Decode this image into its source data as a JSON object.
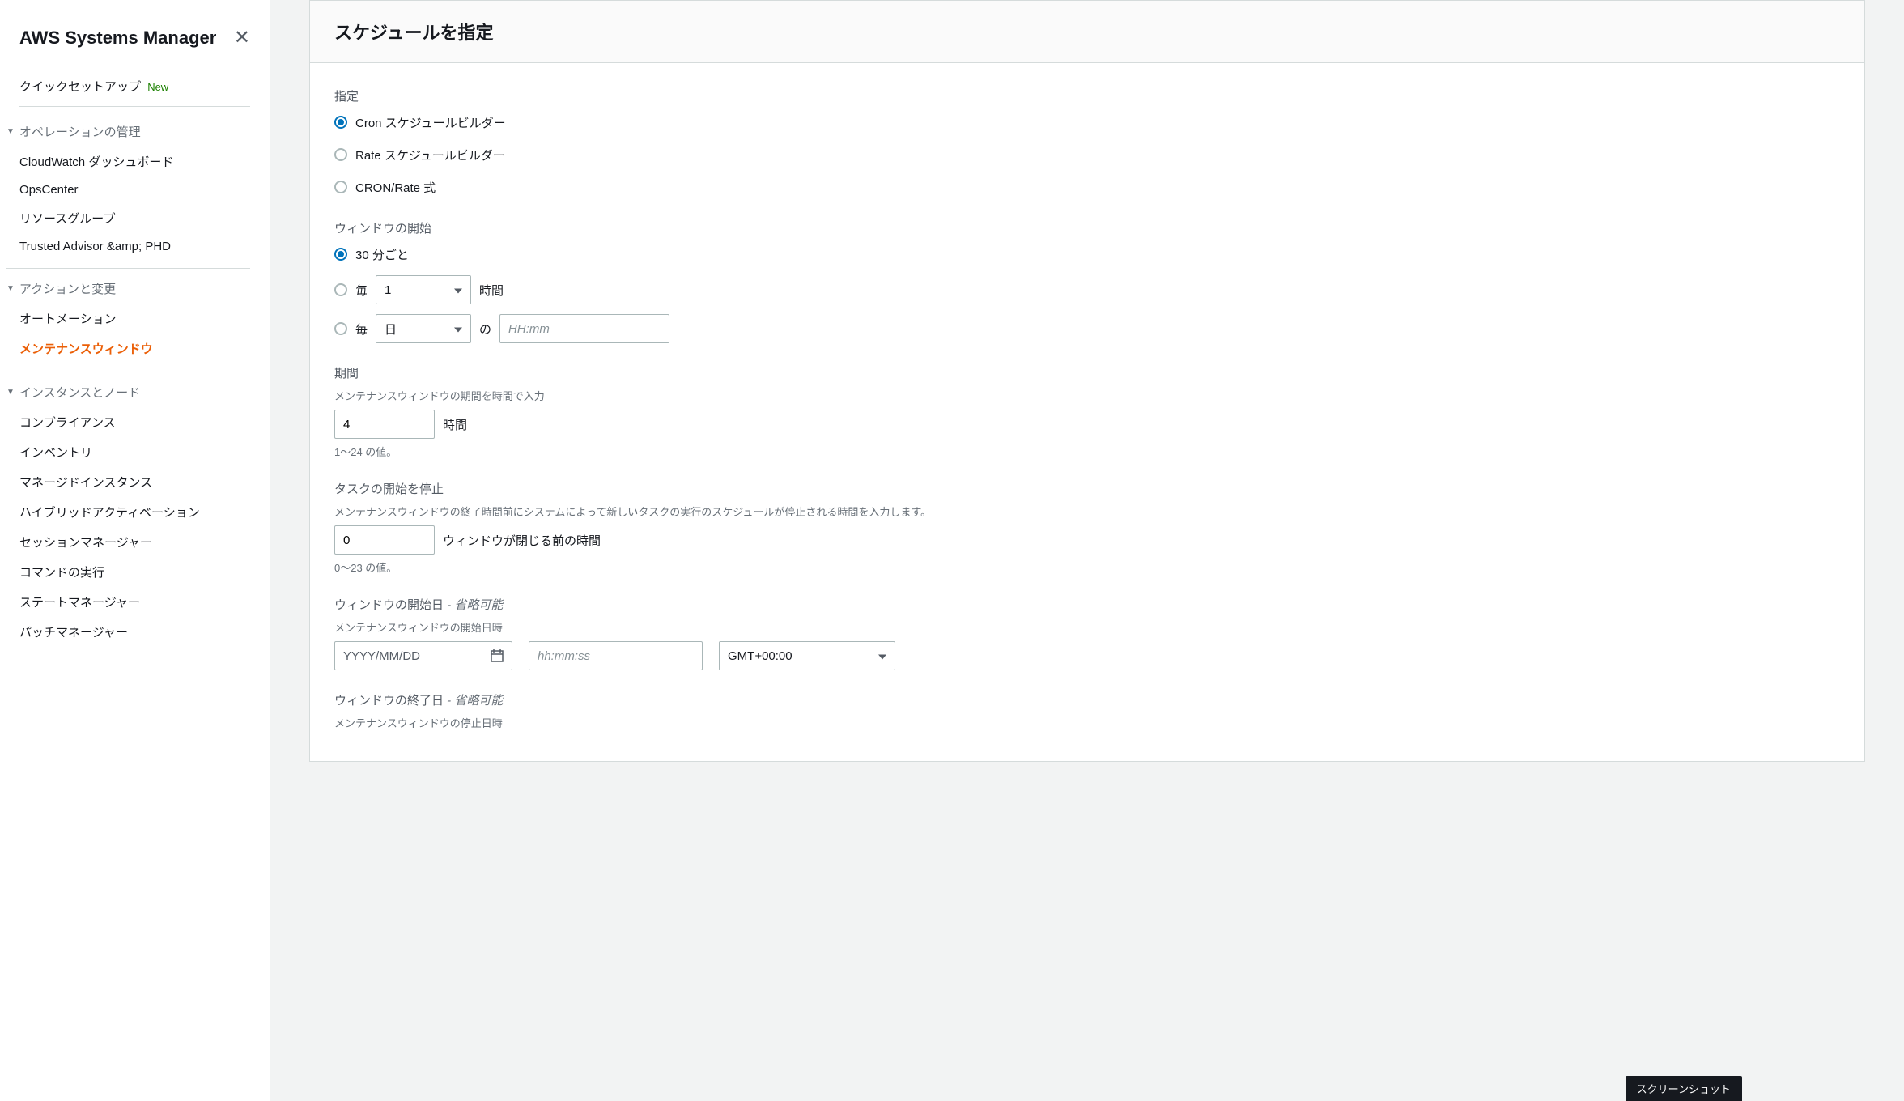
{
  "sidebar": {
    "title": "AWS Systems Manager",
    "quick_setup": "クイックセットアップ",
    "new_badge": "New",
    "sections": [
      {
        "header": "オペレーションの管理",
        "items": [
          "CloudWatch ダッシュボード",
          "OpsCenter",
          "リソースグループ",
          "Trusted Advisor &amp; PHD"
        ]
      },
      {
        "header": "アクションと変更",
        "items": [
          "オートメーション",
          "メンテナンスウィンドウ"
        ],
        "active_index": 1
      },
      {
        "header": "インスタンスとノード",
        "items": [
          "コンプライアンス",
          "インベントリ",
          "マネージドインスタンス",
          "ハイブリッドアクティベーション",
          "セッションマネージャー",
          "コマンドの実行",
          "ステートマネージャー",
          "パッチマネージャー"
        ]
      }
    ]
  },
  "panel": {
    "title": "スケジュールを指定",
    "specify": {
      "label": "指定",
      "options": [
        "Cron スケジュールビルダー",
        "Rate スケジュールビルダー",
        "CRON/Rate 式"
      ]
    },
    "window_start": {
      "label": "ウィンドウの開始",
      "opt_30min": "30 分ごと",
      "opt_every_prefix": "毎",
      "opt_every_value": "1",
      "opt_every_unit": "時間",
      "opt_every_day_prefix": "毎",
      "opt_every_day_value": "日",
      "opt_every_day_sep": "の",
      "opt_time_placeholder": "HH:mm"
    },
    "duration": {
      "label": "期間",
      "hint": "メンテナンスウィンドウの期間を時間で入力",
      "value": "4",
      "suffix": "時間",
      "constraint": "1〜24 の値。"
    },
    "stop_tasks": {
      "label": "タスクの開始を停止",
      "hint": "メンテナンスウィンドウの終了時間前にシステムによって新しいタスクの実行のスケジュールが停止される時間を入力します。",
      "value": "0",
      "suffix": "ウィンドウが閉じる前の時間",
      "constraint": "0〜23 の値。"
    },
    "start_date": {
      "label": "ウィンドウの開始日",
      "optional": " - 省略可能",
      "hint": "メンテナンスウィンドウの開始日時",
      "date_placeholder": "YYYY/MM/DD",
      "time_placeholder": "hh:mm:ss",
      "tz": "GMT+00:00"
    },
    "end_date": {
      "label": "ウィンドウの終了日",
      "optional": " - 省略可能",
      "hint": "メンテナンスウィンドウの停止日時"
    }
  },
  "tooltip": "スクリーンショット"
}
